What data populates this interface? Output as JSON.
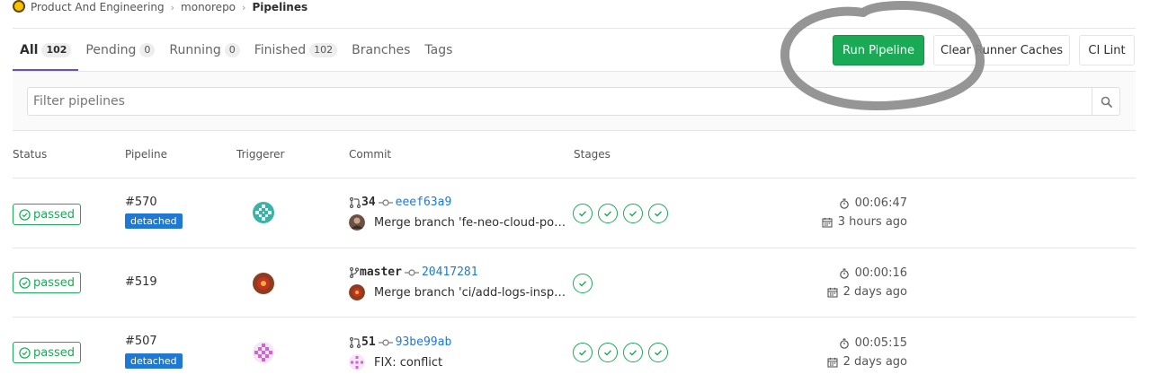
{
  "breadcrumb": {
    "group": "Product And Engineering",
    "project": "monorepo",
    "current": "Pipelines"
  },
  "tabs": [
    {
      "label": "All",
      "count": "102"
    },
    {
      "label": "Pending",
      "count": "0"
    },
    {
      "label": "Running",
      "count": "0"
    },
    {
      "label": "Finished",
      "count": "102"
    },
    {
      "label": "Branches",
      "count": ""
    },
    {
      "label": "Tags",
      "count": ""
    }
  ],
  "actions": {
    "run_pipeline": "Run Pipeline",
    "clear_runner_caches": "Clear Runner Caches",
    "ci_lint": "CI Lint"
  },
  "filter": {
    "placeholder": "Filter pipelines"
  },
  "table": {
    "headers": {
      "status": "Status",
      "pipeline": "Pipeline",
      "triggerer": "Triggerer",
      "commit": "Commit",
      "stages": "Stages"
    },
    "rows": [
      {
        "status": "passed",
        "pipeline_id": "#570",
        "tag": "detached",
        "ref": "34",
        "ref_kind": "merge-request",
        "sha": "eeef63a9",
        "message": "Merge branch 'fe-neo-cloud-po…",
        "stage_count": 4,
        "duration": "00:06:47",
        "finished": "3 hours ago"
      },
      {
        "status": "passed",
        "pipeline_id": "#519",
        "tag": "",
        "ref": "master",
        "ref_kind": "branch",
        "sha": "20417281",
        "message": "Merge branch 'ci/add-logs-insp…",
        "stage_count": 1,
        "duration": "00:00:16",
        "finished": "2 days ago"
      },
      {
        "status": "passed",
        "pipeline_id": "#507",
        "tag": "detached",
        "ref": "51",
        "ref_kind": "merge-request",
        "sha": "93be99ab",
        "message": "FIX: conflict",
        "stage_count": 4,
        "duration": "00:05:15",
        "finished": "2 days ago"
      }
    ]
  },
  "colors": {
    "success": "#1aaa55",
    "link": "#1f78d1",
    "active_tab": "#6b4fbb",
    "detached_badge": "#1f78d1",
    "annotation": "#8c8c8c"
  },
  "icons": {
    "status": "status-success-icon",
    "stage": "check-circle-icon",
    "merge_request": "merge-request-icon",
    "branch": "branch-icon",
    "commit": "commit-icon",
    "duration": "timer-icon",
    "finished": "calendar-icon",
    "search": "search-icon"
  }
}
